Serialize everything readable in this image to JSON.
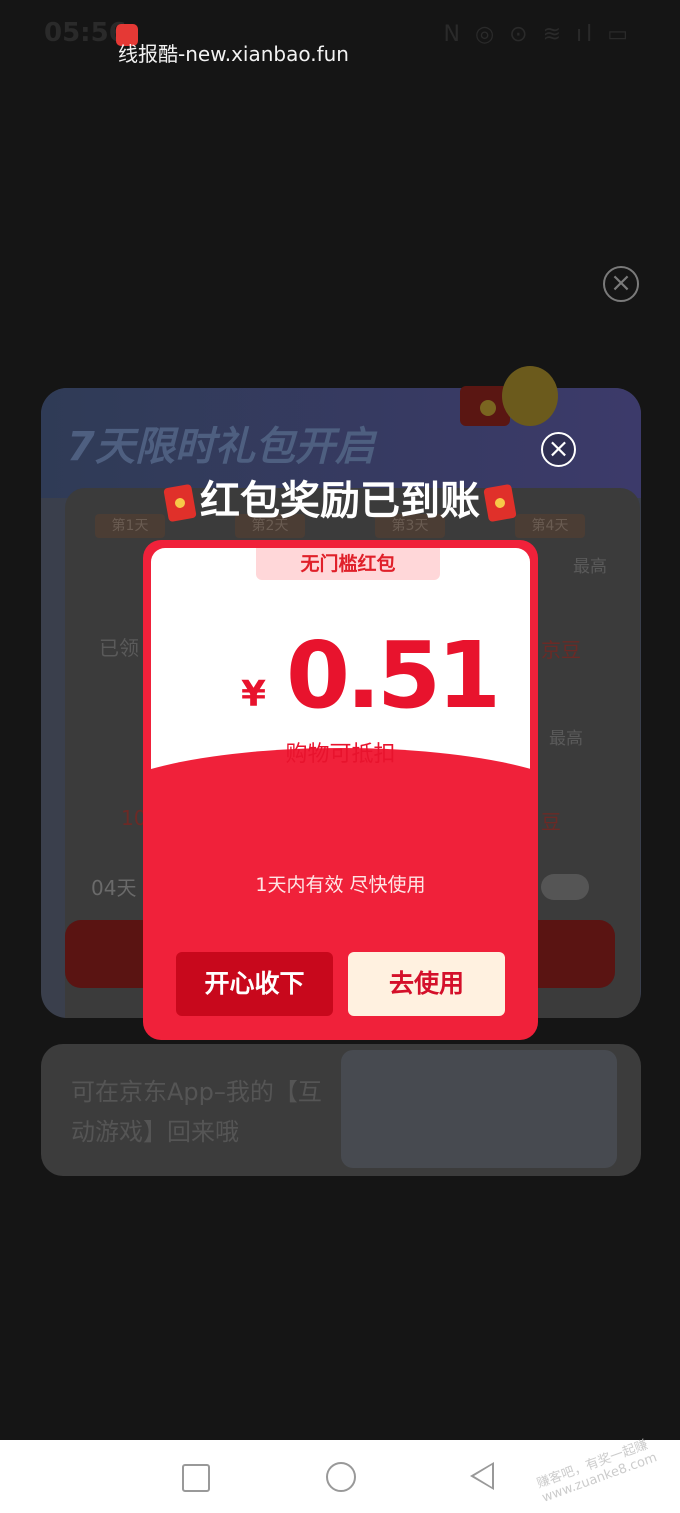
{
  "status_bar": {
    "time": "05:56",
    "watermark": "线报酷-new.xianbao.fun",
    "sys_icons": "N ◎ ⊙ ≋ ıl ▭"
  },
  "background_page": {
    "title": "7天限时礼包开启",
    "days": [
      "第1天",
      "第2天",
      "第3天",
      "第4天"
    ],
    "claimed_label": "已领",
    "jd_bean_label": "京豆",
    "max_label": "最高",
    "row2_value": "10",
    "row2_suffix": "豆",
    "countdown": "04天",
    "bottom_text": "可在京东App–我的【互动游戏】回来哦"
  },
  "modal": {
    "title": "红包奖励已到账",
    "badge": "无门槛红包",
    "currency": "¥",
    "amount": "0.51",
    "deduct_text": "购物可抵扣",
    "validity": "1天内有效 尽快使用",
    "accept_label": "开心收下",
    "use_label": "去使用"
  },
  "footer": {
    "corner_mark": "赚客吧，有奖一起赚 www.zuanke8.com"
  },
  "colors": {
    "modal_red": "#f0213a",
    "amount_red": "#e8132d",
    "accept_button": "#c8081c",
    "use_button_bg": "#fff1e0"
  }
}
